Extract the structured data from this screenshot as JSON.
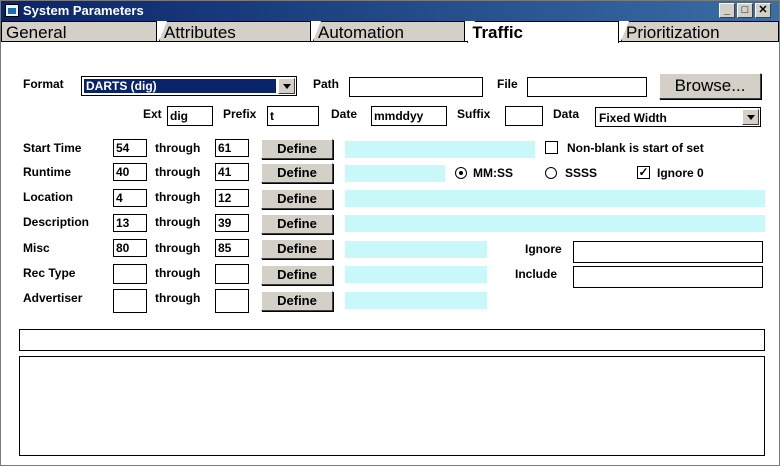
{
  "window": {
    "title": "System Parameters",
    "buttons": [
      "_",
      "□",
      "✕"
    ]
  },
  "tabs": [
    {
      "label": "General",
      "active": false
    },
    {
      "label": "Attributes",
      "active": false
    },
    {
      "label": "Automation",
      "active": false
    },
    {
      "label": "Traffic",
      "active": true
    },
    {
      "label": "Prioritization",
      "active": false
    }
  ],
  "top": {
    "format_label": "Format",
    "format_value": "DARTS (dig)",
    "path_label": "Path",
    "path_value": "",
    "file_label": "File",
    "file_value": "",
    "browse_label": "Browse...",
    "ext_label": "Ext",
    "ext_value": "dig",
    "prefix_label": "Prefix",
    "prefix_value": "t",
    "date_label": "Date",
    "date_value": "mmddyy",
    "suffix_label": "Suffix",
    "suffix_value": "",
    "data_label": "Data",
    "data_value": "Fixed Width"
  },
  "rows": [
    {
      "label": "Start Time",
      "from": "54",
      "through_label": "through",
      "to": "61",
      "button": "Define"
    },
    {
      "label": "Runtime",
      "from": "40",
      "through_label": "through",
      "to": "41",
      "button": "Define"
    },
    {
      "label": "Location",
      "from": "4",
      "through_label": "through",
      "to": "12",
      "button": "Define"
    },
    {
      "label": "Description",
      "from": "13",
      "through_label": "through",
      "to": "39",
      "button": "Define"
    },
    {
      "label": "Misc",
      "from": "80",
      "through_label": "through",
      "to": "85",
      "button": "Define"
    },
    {
      "label": "Rec Type",
      "from": "",
      "through_label": "through",
      "to": "",
      "button": "Define"
    },
    {
      "label": "Advertiser",
      "from": "",
      "through_label": "through",
      "to": "",
      "button": "Define"
    }
  ],
  "options": {
    "nonblank_label": "Non-blank is start of set",
    "nonblank_checked": false,
    "mmss_label": "MM:SS",
    "mmss_selected": true,
    "ssss_label": "SSSS",
    "ssss_selected": false,
    "ignore0_label": "Ignore 0",
    "ignore0_checked": true,
    "ignore_label": "Ignore",
    "ignore_value": "",
    "include_label": "Include",
    "include_value": ""
  },
  "colors": {
    "accent_highlight": "#0a246a",
    "preview_fill": "#c9f8fb",
    "face": "#d4d0c8"
  }
}
